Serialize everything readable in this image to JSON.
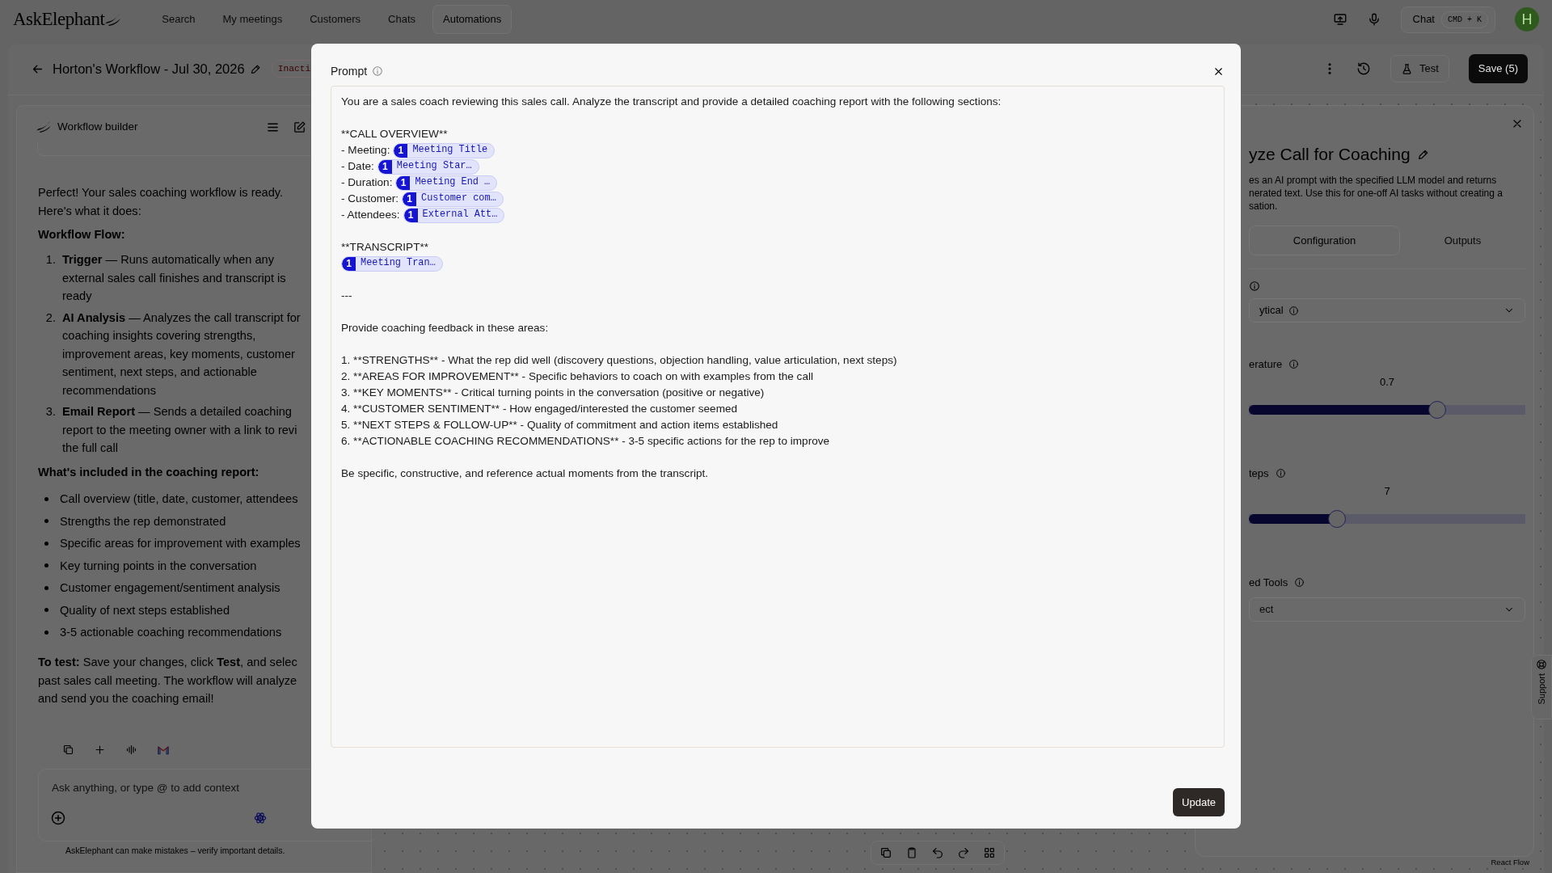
{
  "top_nav": {
    "logo": "AskElephant",
    "items": [
      {
        "label": "Search",
        "selected": false
      },
      {
        "label": "My meetings",
        "selected": false
      },
      {
        "label": "Customers",
        "selected": false
      },
      {
        "label": "Chats",
        "selected": false
      },
      {
        "label": "Automations",
        "selected": true
      }
    ],
    "chat_button": {
      "label": "Chat",
      "shortcut": "CMD + K"
    },
    "avatar": "H"
  },
  "workflow_header": {
    "title": "Horton's Workflow - Jul 30, 2026",
    "status": "Inacti",
    "test_button": "Test",
    "save_button": "Save (5)"
  },
  "chat_panel": {
    "title": "Workflow builder",
    "message": [
      {
        "kind": "paragraph",
        "text": "Perfect! Your sales coaching workflow is ready.\nHere's what it does:"
      },
      {
        "kind": "heading",
        "text": "Workflow Flow:"
      },
      {
        "kind": "ordered",
        "items": [
          {
            "number": "1.",
            "text": "**Trigger** — Runs automatically when any\nexternal sales call finishes and transcript is\nready"
          },
          {
            "number": "2.",
            "text": "**AI Analysis** — Analyzes the call transcript for\ncoaching insights covering strengths,\nimprovement areas, key moments, customer\nsentiment, next steps, and actionable\nrecommendations"
          },
          {
            "number": "3.",
            "text": "**Email Report** — Sends a detailed coaching\nreport to the meeting owner with a link to revi\nthe full call"
          }
        ]
      },
      {
        "kind": "heading",
        "text": "What's included in the coaching report:"
      },
      {
        "kind": "bullets",
        "items": [
          "Call overview (title, date, customer, attendees",
          "Strengths the rep demonstrated",
          "Specific areas for improvement with examples",
          "Key turning points in the conversation",
          "Customer engagement/sentiment analysis",
          "Quality of next steps established",
          "3-5 actionable coaching recommendations"
        ]
      },
      {
        "kind": "paragraph",
        "text": "**To test:** Save your changes, click **Test**, and selec\npast sales call meeting. The workflow will analyze\nand send you the coaching email!"
      }
    ],
    "input_placeholder": "Ask anything, or type @ to add context",
    "disclaimer": "AskElephant can make mistakes – verify important details."
  },
  "config_panel": {
    "title": "yze Call for Coaching",
    "description": "es an AI prompt with the specified LLM model and returns\nnerated text. Use this for one-off AI tasks without creating a\nsation.",
    "tabs": [
      {
        "label": "Configuration",
        "selected": true
      },
      {
        "label": "Outputs",
        "selected": false
      }
    ],
    "select_value": "ytical",
    "sliders": [
      {
        "label": "erature",
        "value": "0.7",
        "level": 0.68
      },
      {
        "label": "teps",
        "value": "7",
        "level": 0.32
      }
    ],
    "tools": {
      "label": "ed Tools",
      "placeholder": "ect"
    }
  },
  "support_tab": "Support",
  "attribution": "React Flow",
  "prompt_dialog": {
    "title": "Prompt",
    "blocks": [
      [
        {
          "text": "You are a sales coach reviewing this sales call. Analyze the transcript and provide a detailed coaching report with the following sections:"
        }
      ],
      [
        {
          "text": "**CALL OVERVIEW**"
        },
        {
          "text": "- Meeting:",
          "chip": {
            "count": "1",
            "label": "Meeting Title"
          }
        },
        {
          "text": "- Date:",
          "chip": {
            "count": "1",
            "label": "Meeting Star…"
          }
        },
        {
          "text": "- Duration:",
          "chip": {
            "count": "1",
            "label": "Meeting End …"
          }
        },
        {
          "text": "- Customer:",
          "chip": {
            "count": "1",
            "label": "Customer com…"
          }
        },
        {
          "text": "- Attendees:",
          "chip": {
            "count": "1",
            "label": "External Att…"
          }
        }
      ],
      [
        {
          "text": "**TRANSCRIPT**"
        },
        {
          "chip": {
            "count": "1",
            "label": "Meeting Tran…"
          }
        }
      ],
      [
        {
          "text": "---"
        }
      ],
      [
        {
          "text": "Provide coaching feedback in these areas:"
        }
      ],
      [
        {
          "text": "1. **STRENGTHS** - What the rep did well (discovery questions, objection handling, value articulation, next steps)"
        },
        {
          "text": "2. **AREAS FOR IMPROVEMENT** - Specific behaviors to coach on with examples from the call"
        },
        {
          "text": "3. **KEY MOMENTS** - Critical turning points in the conversation (positive or negative)"
        },
        {
          "text": "4. **CUSTOMER SENTIMENT** - How engaged/interested the customer seemed"
        },
        {
          "text": "5. **NEXT STEPS & FOLLOW-UP** - Quality of commitment and action items established"
        },
        {
          "text": "6. **ACTIONABLE COACHING RECOMMENDATIONS** - 3-5 specific actions for the rep to improve"
        }
      ],
      [
        {
          "text": "Be specific, constructive, and reference actual moments from the transcript."
        }
      ]
    ],
    "update_button": "Update"
  }
}
